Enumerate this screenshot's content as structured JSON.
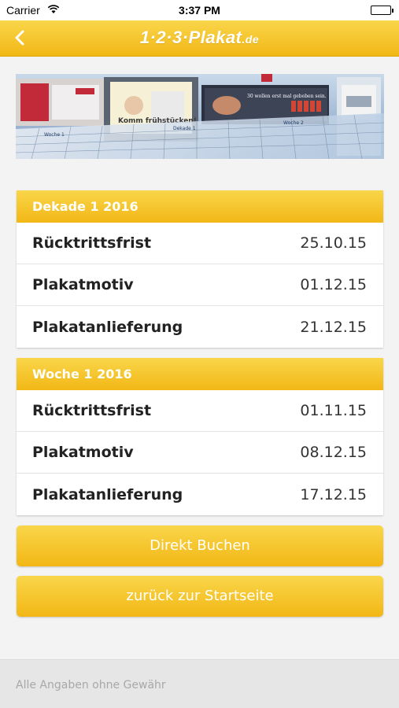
{
  "status_bar": {
    "carrier": "Carrier",
    "time": "3:37 PM",
    "wifi_icon": "wifi-icon",
    "battery_icon": "battery-icon"
  },
  "nav": {
    "back_icon": "chevron-left-icon",
    "logo_text": "1·2·3·Plakat",
    "logo_domain": ".de",
    "accent_color": "#f2b716"
  },
  "banner": {
    "slogan_1": "Komm frühstücken!",
    "slogan_2": "30 wollen erst mal geboben sein.",
    "calendar_labels": [
      "Woche 1",
      "Dekade 1",
      "Woche 2"
    ]
  },
  "sections": [
    {
      "title": "Dekade 1 2016",
      "rows": [
        {
          "label": "Rücktrittsfrist",
          "value": "25.10.15"
        },
        {
          "label": "Plakatmotiv",
          "value": "01.12.15"
        },
        {
          "label": "Plakatanlieferung",
          "value": "21.12.15"
        }
      ]
    },
    {
      "title": "Woche 1 2016",
      "rows": [
        {
          "label": "Rücktrittsfrist",
          "value": "01.11.15"
        },
        {
          "label": "Plakatmotiv",
          "value": "08.12.15"
        },
        {
          "label": "Plakatanlieferung",
          "value": "17.12.15"
        }
      ]
    }
  ],
  "buttons": {
    "book": "Direkt Buchen",
    "home": "zurück zur Startseite"
  },
  "footer": {
    "disclaimer": "Alle Angaben ohne Gewähr"
  }
}
